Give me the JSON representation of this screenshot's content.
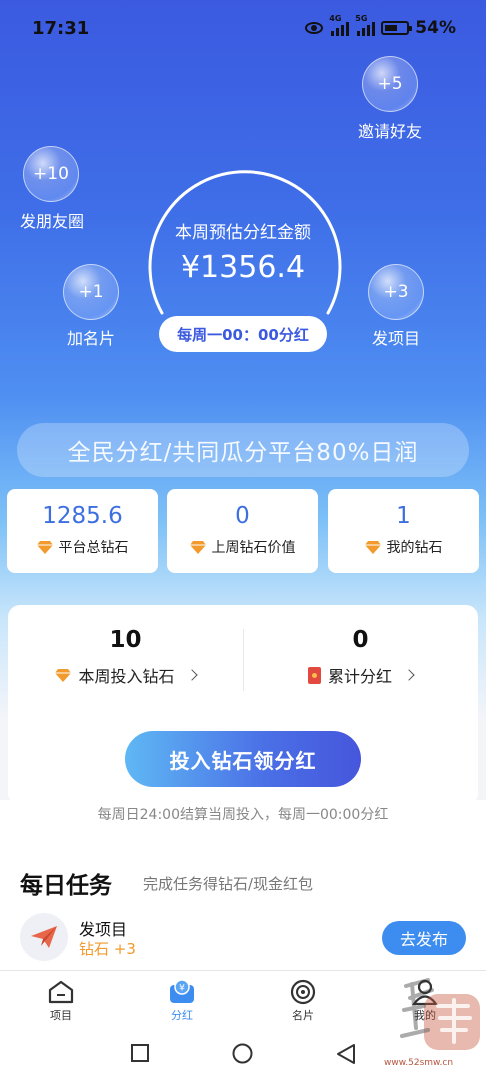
{
  "status": {
    "time": "17:31",
    "battery": "54%",
    "net1": "4G",
    "net2": "5G"
  },
  "bubbles": {
    "invite": {
      "value": "+5",
      "label": "邀请好友"
    },
    "moments": {
      "value": "+10",
      "label": "发朋友圈"
    },
    "card": {
      "value": "+1",
      "label": "加名片"
    },
    "project": {
      "value": "+3",
      "label": "发项目"
    }
  },
  "center": {
    "title": "本周预估分红金额",
    "amount": "¥1356.4",
    "pill": "每周一00：00分红"
  },
  "banner": "全民分红/共同瓜分平台80%日润",
  "stats": [
    {
      "value": "1285.6",
      "label": "平台总钻石"
    },
    {
      "value": "0",
      "label": "上周钻石价值"
    },
    {
      "value": "1",
      "label": "我的钻石"
    }
  ],
  "card": {
    "left": {
      "value": "10",
      "label": "本周投入钻石"
    },
    "right": {
      "value": "0",
      "label": "累计分红"
    },
    "cta": "投入钻石领分红"
  },
  "note": "每周日24:00结算当周投入，每周一00:00分红",
  "tasks": {
    "title": "每日任务",
    "subtitle": "完成任务得钻石/现金红包",
    "items": [
      {
        "name": "发项目",
        "reward": "钻石 +3",
        "button": "去发布"
      }
    ]
  },
  "tabs": [
    {
      "label": "项目",
      "icon": "home-icon"
    },
    {
      "label": "分红",
      "icon": "dividend-icon"
    },
    {
      "label": "名片",
      "icon": "card-icon"
    },
    {
      "label": "我的",
      "icon": "profile-icon"
    }
  ],
  "watermark": "www.52smw.cn",
  "colors": {
    "accent": "#3d8df0",
    "hero_top": "#3b5ae0",
    "reward": "#f29a2c"
  }
}
